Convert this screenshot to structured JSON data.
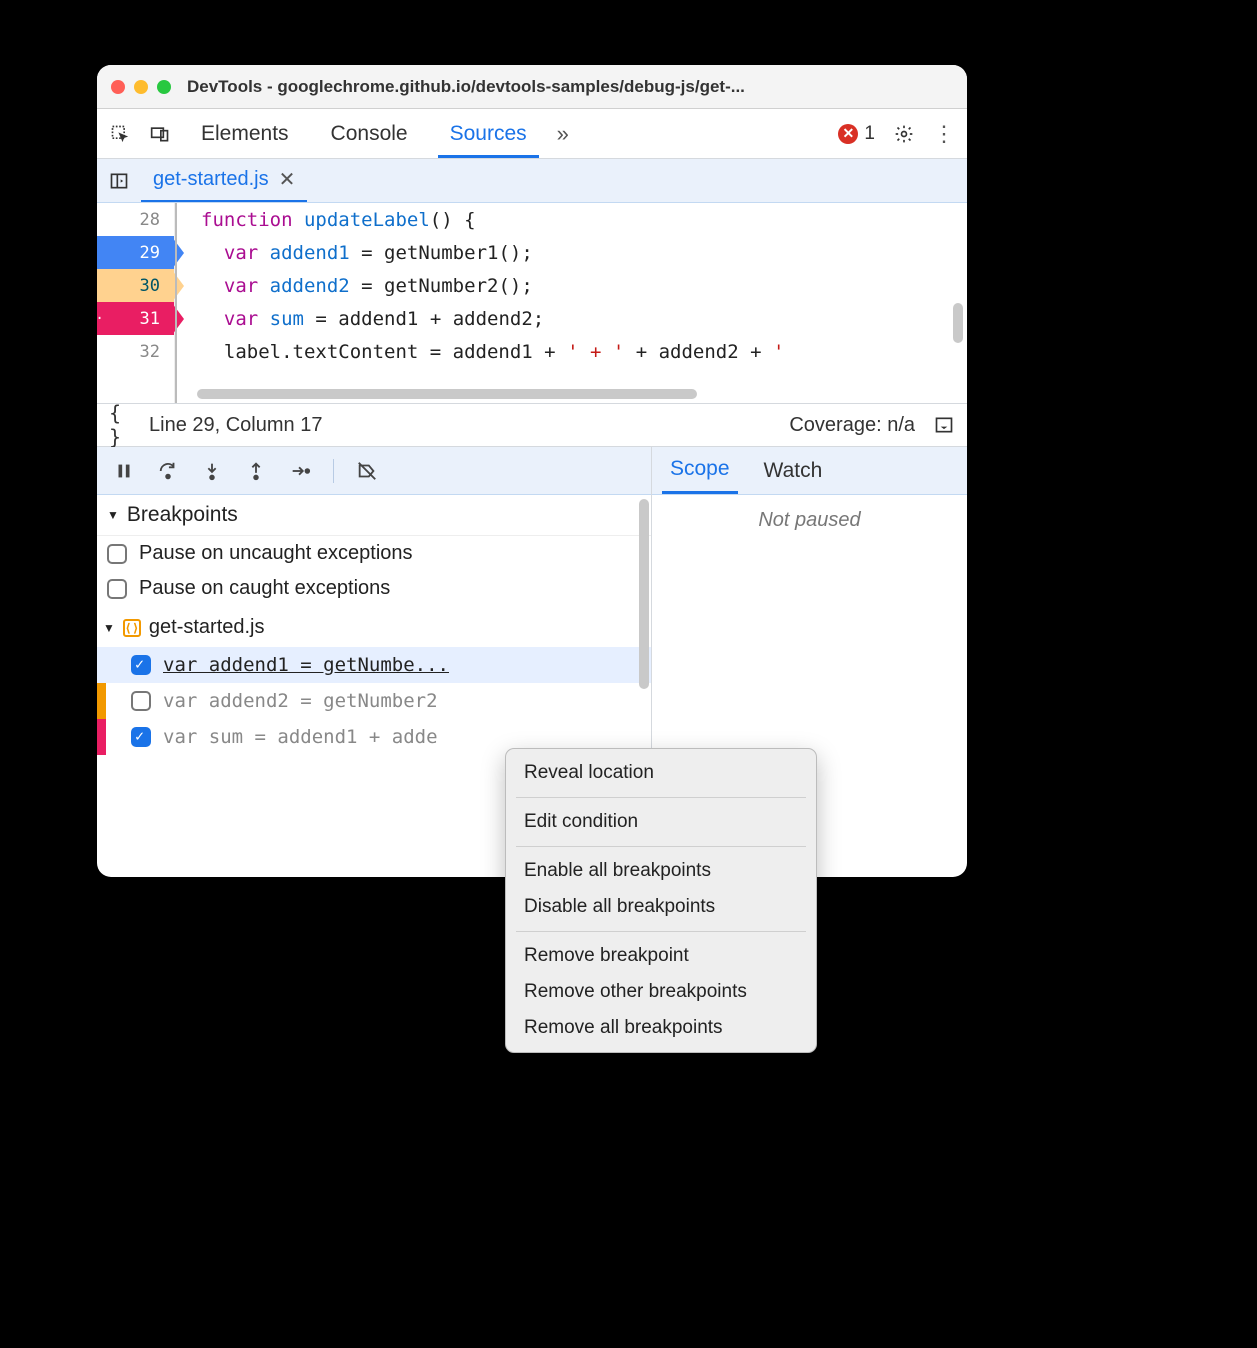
{
  "window": {
    "title": "DevTools - googlechrome.github.io/devtools-samples/debug-js/get-..."
  },
  "tabs": {
    "elements": "Elements",
    "console": "Console",
    "sources": "Sources",
    "error_count": "1"
  },
  "file_tab": {
    "name": "get-started.js"
  },
  "code": {
    "lines": [
      {
        "num": "28",
        "indent": "",
        "tokens": [
          "kw:function ",
          "fn:updateLabel",
          "pl:() {"
        ]
      },
      {
        "num": "29",
        "indent": "  ",
        "tokens": [
          "decl:var ",
          "vn:addend1",
          "pl: = getNumber1();"
        ],
        "bp": "blue"
      },
      {
        "num": "30",
        "indent": "  ",
        "tokens": [
          "decl:var ",
          "vn:addend2",
          "pl: = getNumber2();"
        ],
        "bp": "orange",
        "badge": "?"
      },
      {
        "num": "31",
        "indent": "  ",
        "tokens": [
          "decl:var ",
          "vn:sum",
          "pl: = addend1 + addend2;"
        ],
        "bp": "pink",
        "badge": "··"
      },
      {
        "num": "32",
        "indent": "  ",
        "tokens": [
          "pl:label.textContent = addend1 + ",
          "str:' + '",
          "pl: + addend2 + ",
          "str:'"
        ]
      }
    ]
  },
  "status": {
    "cursor": "Line 29, Column 17",
    "coverage": "Coverage: n/a"
  },
  "right_panel": {
    "scope": "Scope",
    "watch": "Watch",
    "not_paused": "Not paused"
  },
  "breakpoints": {
    "header": "Breakpoints",
    "uncaught": "Pause on uncaught exceptions",
    "caught": "Pause on caught exceptions",
    "file": "get-started.js",
    "items": [
      {
        "text": "var addend1 = getNumbe...",
        "checked": true,
        "color": "blue",
        "active": true
      },
      {
        "text": "var addend2 = getNumber2",
        "checked": false,
        "color": "orange",
        "active": false
      },
      {
        "text": "var sum = addend1 + adde",
        "checked": true,
        "color": "pink",
        "active": false
      }
    ]
  },
  "context_menu": {
    "reveal": "Reveal location",
    "edit": "Edit condition",
    "enable_all": "Enable all breakpoints",
    "disable_all": "Disable all breakpoints",
    "remove": "Remove breakpoint",
    "remove_other": "Remove other breakpoints",
    "remove_all": "Remove all breakpoints"
  }
}
